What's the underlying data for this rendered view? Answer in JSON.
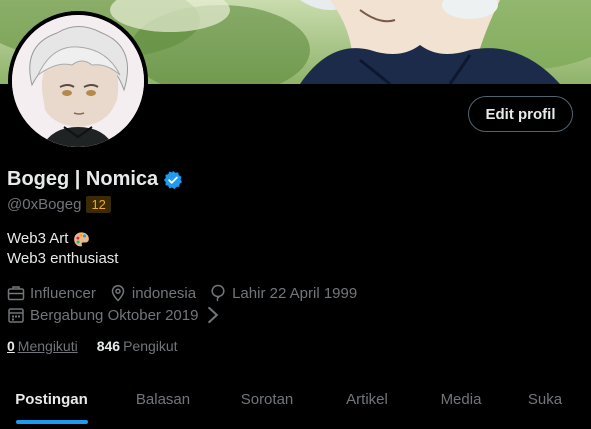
{
  "profile": {
    "display_name": "Bogeg | Nomica",
    "handle": "@0xBogeg",
    "level": "12",
    "bio_line1": "Web3 Art",
    "bio_line2": "Web3 enthusiast",
    "edit_label": "Edit profil"
  },
  "meta": {
    "category": "Influencer",
    "location": "indonesia",
    "birthday": "Lahir 22 April 1999",
    "joined": "Bergabung Oktober 2019"
  },
  "stats": {
    "following_count": "0",
    "following_label": "Mengikuti",
    "followers_count": "846",
    "followers_label": "Pengikut"
  },
  "tabs": [
    {
      "label": "Postingan",
      "active": true
    },
    {
      "label": "Balasan"
    },
    {
      "label": "Sorotan"
    },
    {
      "label": "Artikel"
    },
    {
      "label": "Media"
    },
    {
      "label": "Suka"
    }
  ],
  "colors": {
    "accent": "#1d9bf0",
    "background": "#000000",
    "text_primary": "#e7e9ea",
    "text_secondary": "#71767b",
    "level_badge": "#f5a623"
  },
  "icons": {
    "verified": "verified-badge-icon",
    "palette": "artist-palette-icon",
    "category": "briefcase-icon",
    "location": "location-pin-icon",
    "birthday": "balloon-icon",
    "joined": "calendar-icon",
    "expand": "chevron-right-icon"
  }
}
